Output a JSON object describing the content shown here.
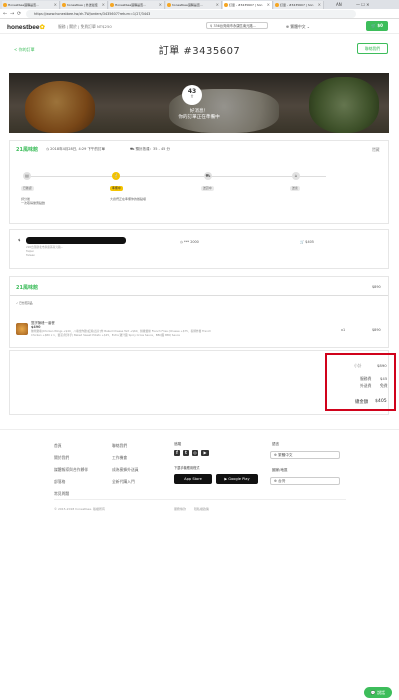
{
  "browser": {
    "tabs": [
      {
        "label": "Honestbee迴購是否..."
      },
      {
        "label": "honestbee | 外送最佳"
      },
      {
        "label": "Honestbee迴購是否..."
      },
      {
        "label": "honestbee迴購是否..."
      },
      {
        "label": "訂單 - #3435607 | hon"
      },
      {
        "label": "訂單 - #3435607 | hon"
      }
    ],
    "close_symbol": "×",
    "user": "AN",
    "window_controls": "— ☐ ✕",
    "url": "https://www.honestbee.tw/zh-TW/orders/3435607?return=1/27/3443",
    "nav": {
      "back": "←",
      "forward": "→",
      "reload": "⟳"
    }
  },
  "header": {
    "logo": "honestbee",
    "nav": "服務 | 關於 | 免費訂單 NT$250",
    "location": "♀ 336台灣南市永康區南元路...",
    "language": "⊕ 繁體中文 ⌄",
    "cart": "🛒 $0"
  },
  "page": {
    "back": "< 你的訂單",
    "title": "訂單 #3435607",
    "contact": "聯絡我們"
  },
  "hero": {
    "timer": "43",
    "timer_unit": "分",
    "line1": "好消息！",
    "line2": "你的訂單正在準備中"
  },
  "status": {
    "shop": "21風味館",
    "date": "◷ 2018年4月28日, 4:29 下午的訂單",
    "eta": "⛟ 預計抵達：35 - 45 分",
    "detail_link": "隱藏",
    "steps": [
      {
        "icon": "▤",
        "label": "已確認",
        "desc": "評分後\n一次取得優惠點數"
      },
      {
        "icon": "🍴",
        "label": "準備中",
        "desc": "大廚們正在準備你的餐點囉"
      },
      {
        "icon": "⛟",
        "label": "送貨中",
        "desc": ""
      },
      {
        "icon": "⌂",
        "label": "送達",
        "desc": ""
      }
    ]
  },
  "address": {
    "lines": [
      "220台灣新北市永康區南元路...",
      "Taipei",
      "Taiwan"
    ],
    "time": "◷ *** 2000",
    "amount": "🛒 $405",
    "prefix": "$"
  },
  "items": {
    "shop": "21風味館",
    "subtotal": "$890",
    "note": "✓ 已分配貨品",
    "name": "雙拼陳峰一番餐",
    "price": "$490",
    "desc1": "無骨雞塊(Chicken Wings +$40、八塊金炸雞)紅燒(四片)炸 Baked Cheese Tart +$60、鮮嫩薯條 French Fries (Cheese +$75、香酥炸薯 French",
    "desc2": "Chicken +$80 x 1、薯泥(附洋芋) Baked Sweet Potato +$25、Extra 雞汁醬 Spicy Cross Sauce、BBQ醬 BBQ Sauce",
    "qty": "x1",
    "total": "$890"
  },
  "summary": {
    "rows": [
      {
        "label": "小計",
        "value": "$890"
      },
      {
        "label": "服務費",
        "value": "$45"
      },
      {
        "label": "外送費",
        "value": "免費"
      }
    ],
    "total_label": "總金額",
    "total_value": "$405"
  },
  "footer": {
    "col1": [
      "首頁",
      "關於我們",
      "媒體報導與合作夥伴",
      "部落格",
      "常見問題"
    ],
    "col2": [
      "聯絡我們",
      "工作機會",
      "成為蜜蜂外送員",
      "全新代購入門"
    ],
    "follow_title": "追蹤",
    "social": [
      "f",
      "t",
      "◎",
      "▶"
    ],
    "download_title": "下載手機應用程式",
    "appstore": " App Store",
    "googleplay": "▶ Google Play",
    "lang_title": "語言",
    "lang_value": "⊕ 繁體中文",
    "country_title": "國家/地區",
    "country_value": "⊕ 台灣",
    "copyright": "© 2015-2018 honestbee. 版權所有",
    "terms": "服務條款",
    "privacy": "隱私權政策"
  },
  "chat": "💬 說話"
}
